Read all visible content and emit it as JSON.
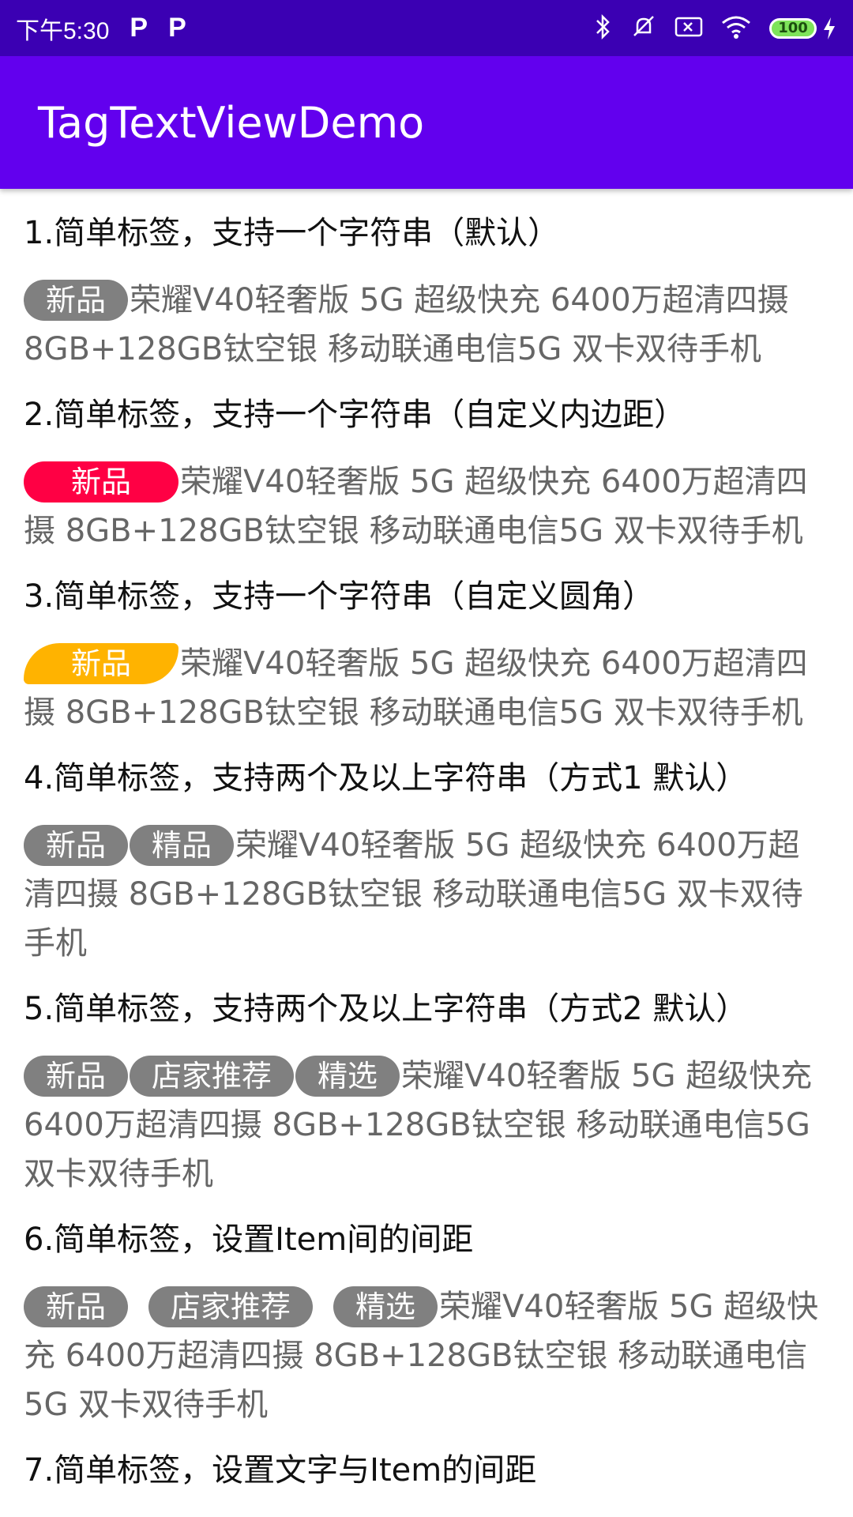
{
  "status_bar": {
    "time": "下午5:30",
    "battery": "100",
    "icons": [
      "p-icon",
      "p-icon",
      "bluetooth-icon",
      "mute-icon",
      "sim-icon",
      "wifi-icon",
      "battery-icon",
      "charging-icon"
    ]
  },
  "app_bar": {
    "title": "TagTextViewDemo"
  },
  "sections": [
    {
      "title": "1.简单标签，支持一个字符串（默认）",
      "tags": [
        "新品"
      ],
      "text": "荣耀V40轻奢版 5G 超级快充 6400万超清四摄 8GB+128GB钛空银 移动联通电信5G 双卡双待手机"
    },
    {
      "title": "2.简单标签，支持一个字符串（自定义内边距）",
      "tags": [
        "新品"
      ],
      "text": "荣耀V40轻奢版 5G 超级快充 6400万超清四摄 8GB+128GB钛空银 移动联通电信5G 双卡双待手机"
    },
    {
      "title": "3.简单标签，支持一个字符串（自定义圆角）",
      "tags": [
        "新品"
      ],
      "text": "荣耀V40轻奢版 5G 超级快充 6400万超清四摄 8GB+128GB钛空银 移动联通电信5G 双卡双待手机"
    },
    {
      "title": "4.简单标签，支持两个及以上字符串（方式1 默认）",
      "tags": [
        "新品",
        "精品"
      ],
      "text": "荣耀V40轻奢版 5G 超级快充 6400万超清四摄 8GB+128GB钛空银 移动联通电信5G 双卡双待手机"
    },
    {
      "title": "5.简单标签，支持两个及以上字符串（方式2 默认）",
      "tags": [
        "新品",
        "店家推荐",
        "精选"
      ],
      "text": "荣耀V40轻奢版 5G 超级快充 6400万超清四摄 8GB+128GB钛空银 移动联通电信5G 双卡双待手机"
    },
    {
      "title": "6.简单标签，设置Item间的间距",
      "tags": [
        "新品",
        "店家推荐",
        "精选"
      ],
      "text": "荣耀V40轻奢版 5G 超级快充 6400万超清四摄 8GB+128GB钛空银 移动联通电信5G 双卡双待手机"
    },
    {
      "title": "7.简单标签，设置文字与Item的间距"
    }
  ],
  "colors": {
    "status_bar": "#3b00b3",
    "app_bar": "#6200ee",
    "tag_gray": "#808080",
    "tag_red": "#ff0044",
    "tag_yellow": "#ffb300"
  }
}
